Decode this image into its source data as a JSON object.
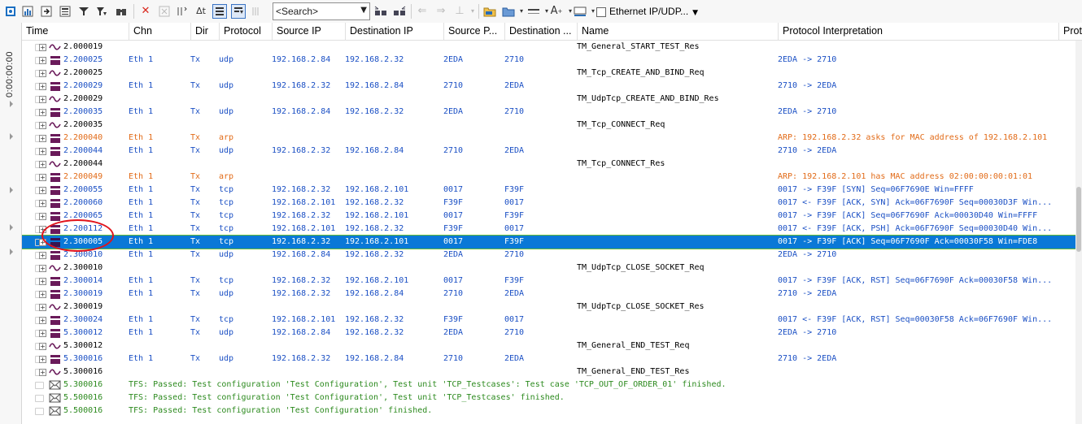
{
  "toolbar": {
    "search_placeholder": "<Search>",
    "filter_label": "Ethernet IP/UDP...",
    "icons": [
      "new-window-icon",
      "chart-icon",
      "export-icon",
      "detail-icon",
      "filter-icon",
      "filter-down-icon",
      "binoculars-icon",
      "clear-icon",
      "clear-disabled-icon",
      "delta-time-icon",
      "pause-icon",
      "scroll-icon",
      "column-icon",
      "search-prev-icon",
      "search-next-icon",
      "back-icon",
      "forward-icon",
      "marker-icon",
      "folder-icon",
      "chn-icon",
      "line-icon",
      "font-icon",
      "color-icon"
    ]
  },
  "sidebar": {
    "elapsed_time": "0:00:00:00"
  },
  "columns": [
    "Time",
    "Chn",
    "Dir",
    "Protocol",
    "Source IP",
    "Destination IP",
    "Source P...",
    "Destination ...",
    "Name",
    "Protocol Interpretation",
    "Proto"
  ],
  "rows": [
    {
      "icon": "signal",
      "time": "2.000019",
      "chn": "",
      "dir": "",
      "proto": "",
      "sip": "",
      "dip": "",
      "sp": "",
      "dp": "",
      "name": "TM_General_START_TEST_Res",
      "interp": "",
      "color": "black"
    },
    {
      "icon": "eth",
      "time": "2.200025",
      "chn": "Eth 1",
      "dir": "Tx",
      "proto": "udp",
      "sip": "192.168.2.84",
      "dip": "192.168.2.32",
      "sp": "2EDA",
      "dp": "2710",
      "name": "",
      "interp": "2EDA -> 2710",
      "color": "blue"
    },
    {
      "icon": "signal",
      "time": "2.200025",
      "chn": "",
      "dir": "",
      "proto": "",
      "sip": "",
      "dip": "",
      "sp": "",
      "dp": "",
      "name": "TM_Tcp_CREATE_AND_BIND_Req",
      "interp": "",
      "color": "black"
    },
    {
      "icon": "eth",
      "time": "2.200029",
      "chn": "Eth 1",
      "dir": "Tx",
      "proto": "udp",
      "sip": "192.168.2.32",
      "dip": "192.168.2.84",
      "sp": "2710",
      "dp": "2EDA",
      "name": "",
      "interp": "2710 -> 2EDA",
      "color": "blue"
    },
    {
      "icon": "signal",
      "time": "2.200029",
      "chn": "",
      "dir": "",
      "proto": "",
      "sip": "",
      "dip": "",
      "sp": "",
      "dp": "",
      "name": "TM_UdpTcp_CREATE_AND_BIND_Res",
      "interp": "",
      "color": "black"
    },
    {
      "icon": "eth",
      "time": "2.200035",
      "chn": "Eth 1",
      "dir": "Tx",
      "proto": "udp",
      "sip": "192.168.2.84",
      "dip": "192.168.2.32",
      "sp": "2EDA",
      "dp": "2710",
      "name": "",
      "interp": "2EDA -> 2710",
      "color": "blue"
    },
    {
      "icon": "signal",
      "time": "2.200035",
      "chn": "",
      "dir": "",
      "proto": "",
      "sip": "",
      "dip": "",
      "sp": "",
      "dp": "",
      "name": "TM_Tcp_CONNECT_Req",
      "interp": "",
      "color": "black"
    },
    {
      "icon": "eth",
      "time": "2.200040",
      "chn": "Eth 1",
      "dir": "Tx",
      "proto": "arp",
      "sip": "",
      "dip": "",
      "sp": "",
      "dp": "",
      "name": "",
      "interp": "ARP: 192.168.2.32 asks for MAC address of 192.168.2.101",
      "color": "orange"
    },
    {
      "icon": "eth",
      "time": "2.200044",
      "chn": "Eth 1",
      "dir": "Tx",
      "proto": "udp",
      "sip": "192.168.2.32",
      "dip": "192.168.2.84",
      "sp": "2710",
      "dp": "2EDA",
      "name": "",
      "interp": "2710 -> 2EDA",
      "color": "blue"
    },
    {
      "icon": "signal",
      "time": "2.200044",
      "chn": "",
      "dir": "",
      "proto": "",
      "sip": "",
      "dip": "",
      "sp": "",
      "dp": "",
      "name": "TM_Tcp_CONNECT_Res",
      "interp": "",
      "color": "black"
    },
    {
      "icon": "eth",
      "time": "2.200049",
      "chn": "Eth 1",
      "dir": "Tx",
      "proto": "arp",
      "sip": "",
      "dip": "",
      "sp": "",
      "dp": "",
      "name": "",
      "interp": "ARP: 192.168.2.101 has MAC address 02:00:00:00:01:01",
      "color": "orange"
    },
    {
      "icon": "eth",
      "time": "2.200055",
      "chn": "Eth 1",
      "dir": "Tx",
      "proto": "tcp",
      "sip": "192.168.2.32",
      "dip": "192.168.2.101",
      "sp": "0017",
      "dp": "F39F",
      "name": "",
      "interp": "0017 -> F39F [SYN] Seq=06F7690E Win=FFFF",
      "color": "blue"
    },
    {
      "icon": "eth",
      "time": "2.200060",
      "chn": "Eth 1",
      "dir": "Tx",
      "proto": "tcp",
      "sip": "192.168.2.101",
      "dip": "192.168.2.32",
      "sp": "F39F",
      "dp": "0017",
      "name": "",
      "interp": "0017 <- F39F [ACK, SYN] Ack=06F7690F Seq=00030D3F Win...",
      "color": "blue"
    },
    {
      "icon": "eth",
      "time": "2.200065",
      "chn": "Eth 1",
      "dir": "Tx",
      "proto": "tcp",
      "sip": "192.168.2.32",
      "dip": "192.168.2.101",
      "sp": "0017",
      "dp": "F39F",
      "name": "",
      "interp": "0017 -> F39F [ACK] Seq=06F7690F Ack=00030D40 Win=FFFF",
      "color": "blue"
    },
    {
      "icon": "eth",
      "time": "2.200112",
      "chn": "Eth 1",
      "dir": "Tx",
      "proto": "tcp",
      "sip": "192.168.2.101",
      "dip": "192.168.2.32",
      "sp": "F39F",
      "dp": "0017",
      "name": "",
      "interp": "0017 <- F39F [ACK, PSH] Ack=06F7690F Seq=00030D40 Win...",
      "color": "blue"
    },
    {
      "icon": "eth",
      "time": "2.300005",
      "chn": "Eth 1",
      "dir": "Tx",
      "proto": "tcp",
      "sip": "192.168.2.32",
      "dip": "192.168.2.101",
      "sp": "0017",
      "dp": "F39F",
      "name": "",
      "interp": "0017 -> F39F [ACK] Seq=06F7690F Ack=00030F58 Win=FDE8",
      "color": "blue",
      "selected": true
    },
    {
      "icon": "eth",
      "time": "2.300010",
      "chn": "Eth 1",
      "dir": "Tx",
      "proto": "udp",
      "sip": "192.168.2.84",
      "dip": "192.168.2.32",
      "sp": "2EDA",
      "dp": "2710",
      "name": "",
      "interp": "2EDA -> 2710",
      "color": "blue"
    },
    {
      "icon": "signal",
      "time": "2.300010",
      "chn": "",
      "dir": "",
      "proto": "",
      "sip": "",
      "dip": "",
      "sp": "",
      "dp": "",
      "name": "TM_UdpTcp_CLOSE_SOCKET_Req",
      "interp": "",
      "color": "black"
    },
    {
      "icon": "eth",
      "time": "2.300014",
      "chn": "Eth 1",
      "dir": "Tx",
      "proto": "tcp",
      "sip": "192.168.2.32",
      "dip": "192.168.2.101",
      "sp": "0017",
      "dp": "F39F",
      "name": "",
      "interp": "0017 -> F39F [ACK, RST] Seq=06F7690F Ack=00030F58 Win...",
      "color": "blue"
    },
    {
      "icon": "eth",
      "time": "2.300019",
      "chn": "Eth 1",
      "dir": "Tx",
      "proto": "udp",
      "sip": "192.168.2.32",
      "dip": "192.168.2.84",
      "sp": "2710",
      "dp": "2EDA",
      "name": "",
      "interp": "2710 -> 2EDA",
      "color": "blue"
    },
    {
      "icon": "signal",
      "time": "2.300019",
      "chn": "",
      "dir": "",
      "proto": "",
      "sip": "",
      "dip": "",
      "sp": "",
      "dp": "",
      "name": "TM_UdpTcp_CLOSE_SOCKET_Res",
      "interp": "",
      "color": "black"
    },
    {
      "icon": "eth",
      "time": "2.300024",
      "chn": "Eth 1",
      "dir": "Tx",
      "proto": "tcp",
      "sip": "192.168.2.101",
      "dip": "192.168.2.32",
      "sp": "F39F",
      "dp": "0017",
      "name": "",
      "interp": "0017 <- F39F [ACK, RST] Seq=00030F58 Ack=06F7690F Win...",
      "color": "blue"
    },
    {
      "icon": "eth",
      "time": "5.300012",
      "chn": "Eth 1",
      "dir": "Tx",
      "proto": "udp",
      "sip": "192.168.2.84",
      "dip": "192.168.2.32",
      "sp": "2EDA",
      "dp": "2710",
      "name": "",
      "interp": "2EDA -> 2710",
      "color": "blue"
    },
    {
      "icon": "signal",
      "time": "5.300012",
      "chn": "",
      "dir": "",
      "proto": "",
      "sip": "",
      "dip": "",
      "sp": "",
      "dp": "",
      "name": "TM_General_END_TEST_Req",
      "interp": "",
      "color": "black"
    },
    {
      "icon": "eth",
      "time": "5.300016",
      "chn": "Eth 1",
      "dir": "Tx",
      "proto": "udp",
      "sip": "192.168.2.32",
      "dip": "192.168.2.84",
      "sp": "2710",
      "dp": "2EDA",
      "name": "",
      "interp": "2710 -> 2EDA",
      "color": "blue"
    },
    {
      "icon": "signal",
      "time": "5.300016",
      "chn": "",
      "dir": "",
      "proto": "",
      "sip": "",
      "dip": "",
      "sp": "",
      "dp": "",
      "name": "TM_General_END_TEST_Res",
      "interp": "",
      "color": "black"
    },
    {
      "icon": "msg",
      "time": "5.300016",
      "tfs": "TFS: Passed: Test configuration 'Test Configuration', Test unit 'TCP_Testcases': Test case 'TCP_OUT_OF_ORDER_01' finished.",
      "color": "green"
    },
    {
      "icon": "msg",
      "time": "5.500016",
      "tfs": "TFS: Passed: Test configuration 'Test Configuration', Test unit 'TCP_Testcases' finished.",
      "color": "green"
    },
    {
      "icon": "msg",
      "time": "5.500016",
      "tfs": "TFS: Passed: Test configuration 'Test Configuration' finished.",
      "color": "green"
    }
  ],
  "colors": {
    "selection": "#0a78d7",
    "blue_text": "#1a4fc4",
    "orange_text": "#e26b18",
    "green_text": "#2c8a1e",
    "annotation": "#e1141b"
  }
}
